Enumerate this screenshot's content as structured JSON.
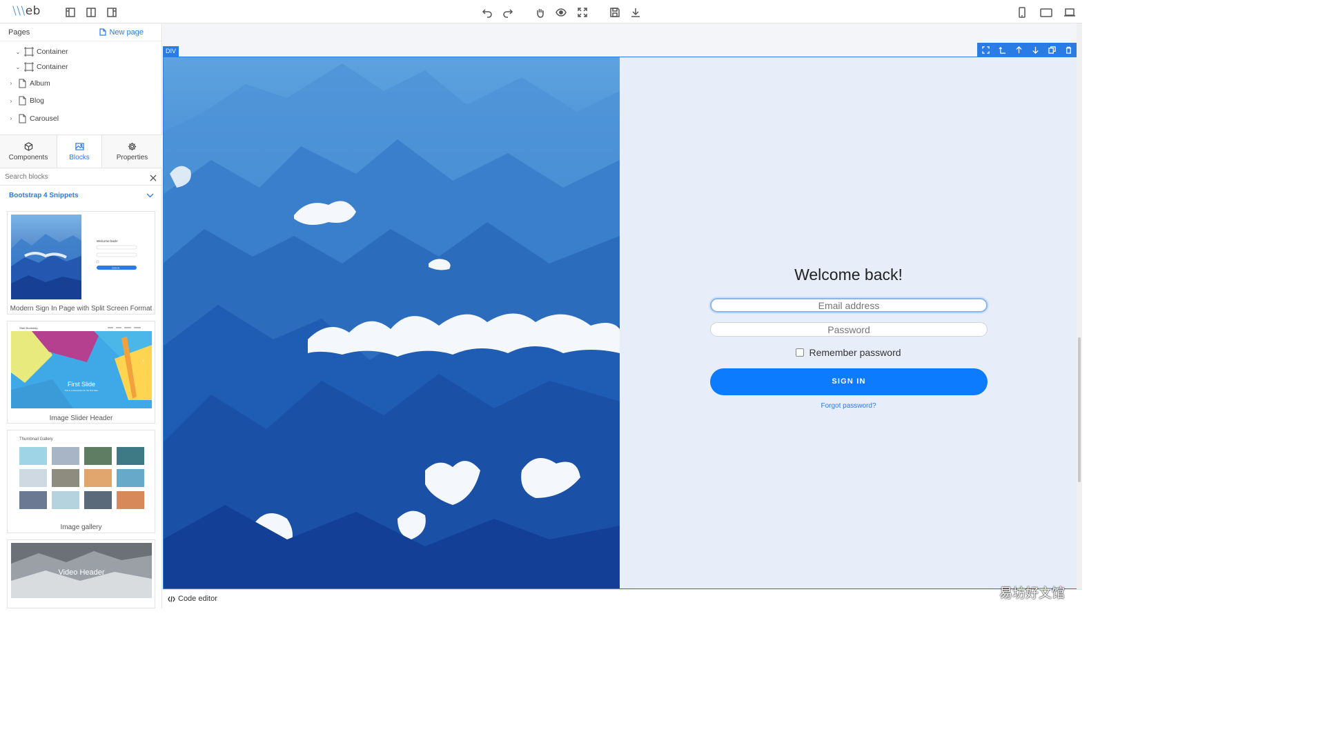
{
  "app": {
    "logo_prefix": "\\\\\\",
    "logo_text": "eb"
  },
  "pages_panel": {
    "title": "Pages",
    "new_page": "New page",
    "tree": [
      {
        "label": "Container",
        "expanded": true,
        "icon": "container-icon"
      },
      {
        "label": "Container",
        "expanded": true,
        "icon": "container-icon"
      },
      {
        "label": "Album",
        "expanded": false,
        "icon": "file-icon"
      },
      {
        "label": "Blog",
        "expanded": false,
        "icon": "file-icon"
      },
      {
        "label": "Carousel",
        "expanded": false,
        "icon": "file-icon"
      }
    ]
  },
  "tabs": [
    {
      "label": "Components",
      "icon": "cube-icon"
    },
    {
      "label": "Blocks",
      "icon": "image-icon",
      "active": true
    },
    {
      "label": "Properties",
      "icon": "gear-icon"
    }
  ],
  "search": {
    "placeholder": "Search blocks"
  },
  "blocks": {
    "section": "Bootstrap 4 Snippets",
    "items": [
      {
        "label": "Modern Sign In Page with Split Screen Format",
        "thumb_title": "Welcome back!",
        "thumb_button": "SIGN IN"
      },
      {
        "label": "Image Slider Header",
        "thumb_brand": "Start Bootstrap",
        "thumb_caption": "First Slide",
        "thumb_sub": "This is a description for the first slide."
      },
      {
        "label": "Image gallery",
        "thumb_title": "Thumbnail Gallery"
      },
      {
        "label": "Video Header",
        "thumb_caption": "Video Header"
      }
    ]
  },
  "canvas": {
    "selected_tag": "DIV",
    "login": {
      "title": "Welcome back!",
      "email_placeholder": "Email address",
      "password_placeholder": "Password",
      "remember": "Remember password",
      "signin": "SIGN IN",
      "forgot": "Forgot password?"
    }
  },
  "bottom": {
    "code_editor": "Code editor"
  },
  "watermark": "易坊好文馆",
  "colors": {
    "accent": "#2a7be4",
    "button": "#0d7bfd",
    "login_bg": "#e8eef9"
  }
}
